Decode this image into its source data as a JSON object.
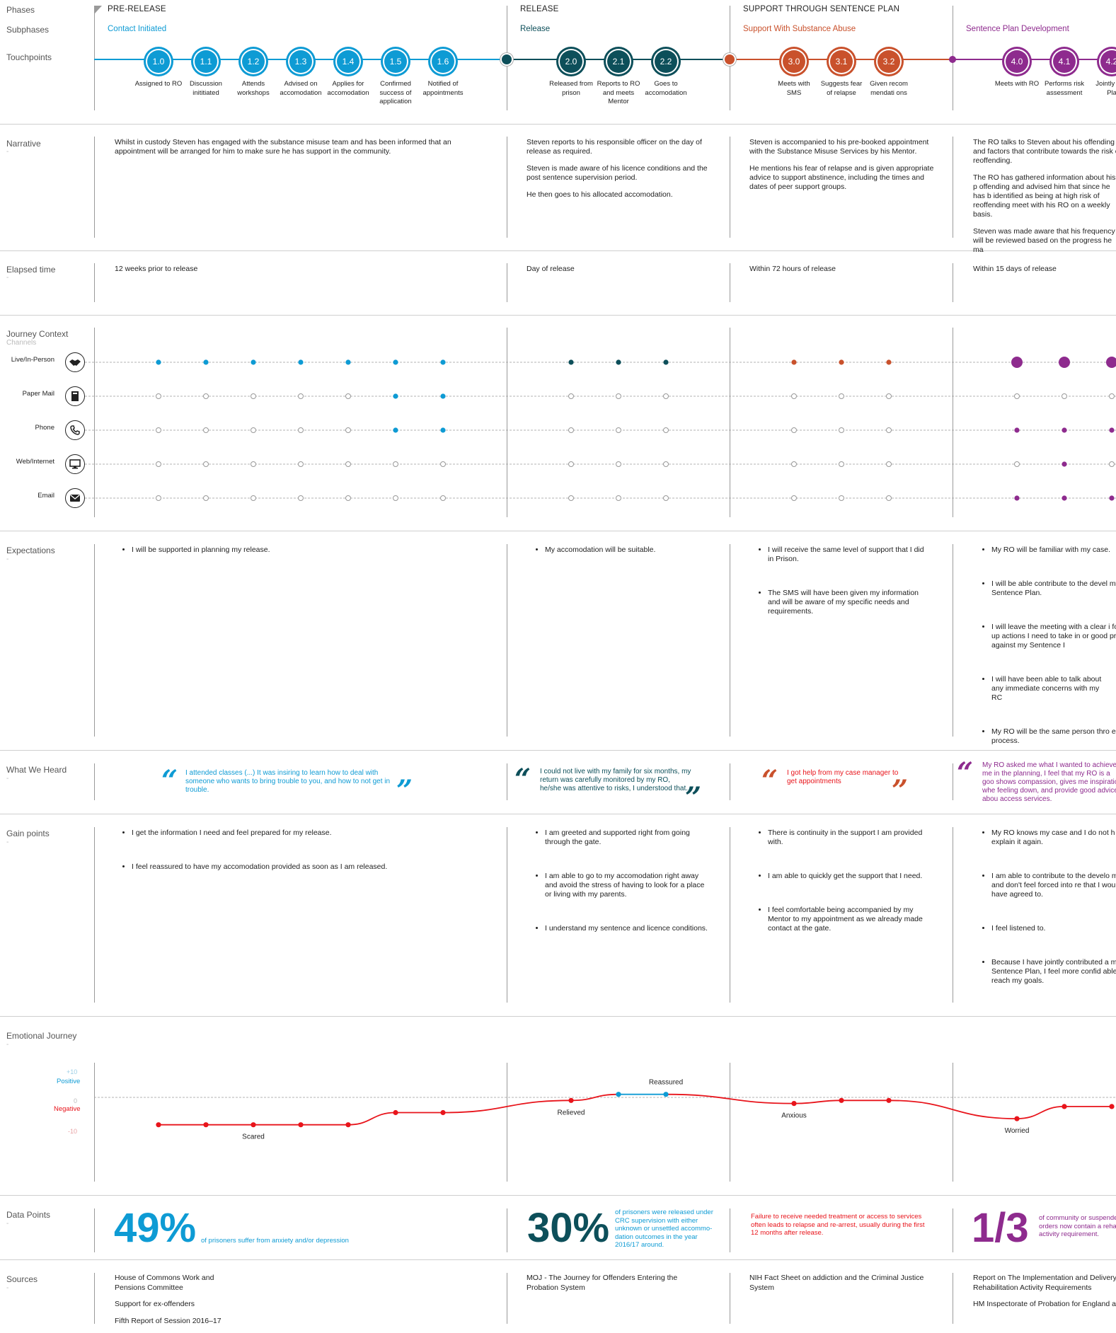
{
  "row_labels": {
    "phases": "Phases",
    "subphases": "Subphases",
    "touchpoints": "Touchpoints",
    "narrative": "Narrative",
    "elapsed_time": "Elapsed time",
    "journey_context": "Journey Context",
    "channels": "Channels",
    "expectations": "Expectations",
    "what_we_heard": "What We Heard",
    "gain_points": "Gain points",
    "emotional_journey": "Emotional Journey",
    "data_points": "Data Points",
    "sources": "Sources",
    "dash": "-"
  },
  "colors": {
    "blue": "#0e9bd4",
    "teal": "#0d4f5a",
    "orange": "#c9512c",
    "purple": "#8e2b8e",
    "red": "#e8141b"
  },
  "phases": [
    "PRE-RELEASE",
    "RELEASE",
    "SUPPORT THROUGH SENTENCE PLAN"
  ],
  "subphases": [
    "Contact Initiated",
    "Release",
    "Support With Substance Abuse",
    "Sentence Plan Development"
  ],
  "touchpoints": [
    {
      "num": "1.0",
      "label": "Assigned to RO"
    },
    {
      "num": "1.1",
      "label": "Discussion inititiated"
    },
    {
      "num": "1.2",
      "label": "Attends workshops"
    },
    {
      "num": "1.3",
      "label": "Advised on accomodation"
    },
    {
      "num": "1.4",
      "label": "Applies for accomodation"
    },
    {
      "num": "1.5",
      "label": "Confirmed success of application"
    },
    {
      "num": "1.6",
      "label": "Notified of appointments"
    },
    {
      "num": "2.0",
      "label": "Released from prison"
    },
    {
      "num": "2.1",
      "label": "Reports to RO and meets Mentor"
    },
    {
      "num": "2.2",
      "label": "Goes to accomodation"
    },
    {
      "num": "3.0",
      "label": "Meets with SMS"
    },
    {
      "num": "3.1",
      "label": "Suggests fear of relapse"
    },
    {
      "num": "3.2",
      "label": "Given recommendati ons"
    },
    {
      "num": "4.0",
      "label": "Meets with RO"
    },
    {
      "num": "4.1",
      "label": "Performs risk assessment"
    },
    {
      "num": "4.2",
      "label": "Jointly a to Pla"
    }
  ],
  "narrative": {
    "col1": [
      "Whilst in custody Steven has engaged with the substance misuse team and has been informed that an appointment will be arranged for him to make sure he has support in the community."
    ],
    "col2": [
      "Steven reports to his responsible officer on the day of release as required.",
      "Steven is made aware of his licence conditions and the post sentence supervision period.",
      "He then goes to his allocated accomodation."
    ],
    "col3": [
      "Steven is accompanied to his pre-booked appointment with the Substance Misuse Services by his Mentor.",
      "He mentions his fear of relapse and is given appropriate advice to support abstinence, including the times and dates of peer support groups."
    ],
    "col4": [
      "The RO talks to Steven about his offending b and factors that contribute towards the risk c reoffending.",
      "The RO has gathered information about his p offending and advised him that since he has b identified as being at high risk of reoffending meet with his RO on a weekly basis.",
      "Steven was made aware that his frequency o will be reviewed based on the progress he ma"
    ]
  },
  "elapsed": [
    "12 weeks prior to release",
    "Day of release",
    "Within 72 hours of release",
    "Within 15 days of release"
  ],
  "channels": [
    {
      "label": "Live/In-Person",
      "icon": "handshake-icon",
      "glyph": "🤝"
    },
    {
      "label": "Paper Mail",
      "icon": "paper-mail-icon",
      "glyph": "▯"
    },
    {
      "label": "Phone",
      "icon": "phone-icon",
      "glyph": "✆"
    },
    {
      "label": "Web/Internet",
      "icon": "monitor-icon",
      "glyph": "▭"
    },
    {
      "label": "Email",
      "icon": "email-icon",
      "glyph": "✉"
    }
  ],
  "channel_usage": [
    [
      1,
      1,
      1,
      1,
      1,
      1,
      1,
      1,
      1,
      1,
      1,
      1,
      1,
      2,
      2,
      2
    ],
    [
      0,
      0,
      0,
      0,
      0,
      1,
      1,
      0,
      0,
      0,
      0,
      0,
      0,
      0,
      0,
      0
    ],
    [
      0,
      0,
      0,
      0,
      0,
      1,
      1,
      0,
      0,
      0,
      0,
      0,
      0,
      1,
      1,
      1
    ],
    [
      0,
      0,
      0,
      0,
      0,
      0,
      0,
      0,
      0,
      0,
      0,
      0,
      0,
      0,
      1,
      0
    ],
    [
      0,
      0,
      0,
      0,
      0,
      0,
      0,
      0,
      0,
      0,
      0,
      0,
      0,
      1,
      1,
      1
    ]
  ],
  "expectations": {
    "col1": [
      "I will be supported in planning my release."
    ],
    "col2": [
      "My accomodation will be suitable."
    ],
    "col3": [
      "I will receive the same level of support that I did in Prison.",
      "The SMS will have been given my information and will be aware of my specific needs and requirements."
    ],
    "col4": [
      "My RO will be familiar with my case.",
      "I will be able contribute to the devel my Sentence Plan.",
      "I will leave the meeting with a clear i follow up actions I need to take in or good progress against my Sentence I",
      "I will have been able to talk about any immediate concerns with my RC",
      "My RO will be the same person thro entire process."
    ]
  },
  "quotes": [
    "I attended classes (...) It was insiring to learn how to deal with someone who wants to bring trouble to you, and how to not get in trouble.",
    "I could not live with my family for six months, my return was carefully monitored by my RO, he/she was attentive to risks, I understood that.",
    "I got help from my case manager to get appointments",
    "My RO asked me what I wanted to achieve a me in the planning, I feel that my RO is a goo shows compassion, gives me inspiration whe feeling down, and provide good advice abou access services."
  ],
  "gain_points": {
    "col1": [
      "I get the information I need and feel prepared for my release.",
      "I feel reassured to have my accomodation provided as soon as I am released."
    ],
    "col2": [
      "I am greeted and supported right from going through the gate.",
      "I am able to go to my accomodation right away and avoid the stress of having to look for a place or living with my parents.",
      "I understand my sentence and licence conditions."
    ],
    "col3": [
      "There is continuity in the support I am provided with.",
      "I am able to quickly get the support that I need.",
      "I feel comfortable being accompanied by my Mentor to my appointment as we already made contact at the gate."
    ],
    "col4": [
      "My RO knows my case and I do not h explain it again.",
      "I am able to contribute to the develo my plan and don't feel forced into re that I would not have agreed to.",
      "I feel listened to.",
      "Because I have jointly contributed a my Sentence Plan, I feel more confid able to reach my goals."
    ]
  },
  "chart_data": {
    "type": "line",
    "title": "",
    "scale": {
      "top": "+10",
      "positive": "Positive",
      "zero": "0",
      "negative": "Negative",
      "bottom": "-10"
    },
    "ylim": [
      -10,
      10
    ],
    "x": [
      "1.0",
      "1.1",
      "1.2",
      "1.3",
      "1.4",
      "1.5",
      "1.6",
      "2.0",
      "2.1",
      "2.2",
      "3.0",
      "3.1",
      "3.2",
      "4.0",
      "4.1",
      "4.2"
    ],
    "values": [
      -9,
      -9,
      -9,
      -9,
      -9,
      -5,
      -5,
      -1,
      1,
      1,
      -2,
      -1,
      -1,
      -7,
      -3,
      -3
    ],
    "annotations": [
      {
        "index": 2,
        "text": "Scared"
      },
      {
        "index": 7,
        "text": "Relieved"
      },
      {
        "index": 9,
        "text": "Reassured"
      },
      {
        "index": 10,
        "text": "Anxious"
      },
      {
        "index": 13,
        "text": "Worried"
      }
    ]
  },
  "data_points": [
    {
      "value": "49%",
      "desc": "of prisoners suffer from anxiety and/or depression"
    },
    {
      "value": "30%",
      "desc": "of prisoners were released under CRC supervision with either unknown or unsettled accommo- dation outcomes in the year 2016/17 around."
    },
    {
      "value": "",
      "desc": "Failure to receive needed treatment or access to services often leads to relapse and re-arrest, usually during the first 12 months after release."
    },
    {
      "value": "1/3",
      "desc": "of community or suspende orders now contain a reha activity requirement."
    }
  ],
  "sources": {
    "col1": [
      "House of Commons Work and Pensions Committee",
      "Support for  ex-offenders",
      "Fifth Report of Session 2016–17"
    ],
    "col2": [
      "MOJ - The Journey for Offenders Entering the Probation System"
    ],
    "col3": [
      "NIH Fact Sheet on addiction and the Criminal Justice System"
    ],
    "col4": [
      "Report on The Implementation and Delivery Rehabilitation Activity Requirements",
      "HM Inspectorate of Probation for England an"
    ]
  }
}
